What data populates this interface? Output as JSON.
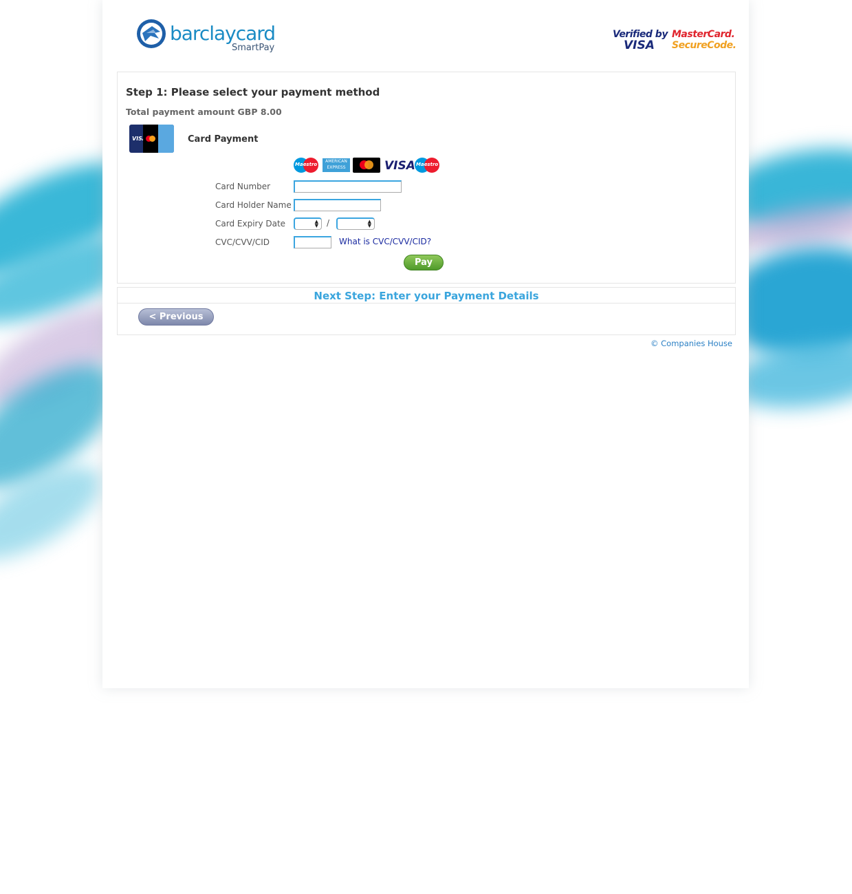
{
  "header": {
    "logo_word": "barclaycard",
    "logo_sub": "SmartPay",
    "vbv_line1": "Verified by",
    "vbv_line2": "VISA",
    "msc_line1": "MasterCard.",
    "msc_line2": "SecureCode."
  },
  "step": {
    "title": "Step 1: Please select your payment method",
    "total": "Total payment amount GBP 8.00"
  },
  "method": {
    "label": "Card Payment",
    "icon_visa_text": "VISA"
  },
  "brands": {
    "maestro": "Maestro",
    "amex": "AMERICAN EXPRESS",
    "visa": "VISA"
  },
  "form": {
    "card_number_label": "Card Number",
    "card_number_value": "",
    "card_holder_label": "Card Holder Name",
    "card_holder_value": "",
    "expiry_label": "Card Expiry Date",
    "expiry_month_value": "",
    "expiry_year_value": "",
    "expiry_separator": "/",
    "cvc_label": "CVC/CVV/CID",
    "cvc_value": "",
    "cvc_help_link": "What is CVC/CVV/CID?",
    "pay_label": "Pay"
  },
  "next": {
    "title": "Next Step: Enter your Payment Details",
    "previous_label": "< Previous"
  },
  "footer": {
    "copyright": "© Companies House"
  },
  "colors": {
    "accent": "#3aa5dd",
    "pay_green": "#5aa830",
    "link": "#1a2aa0"
  }
}
